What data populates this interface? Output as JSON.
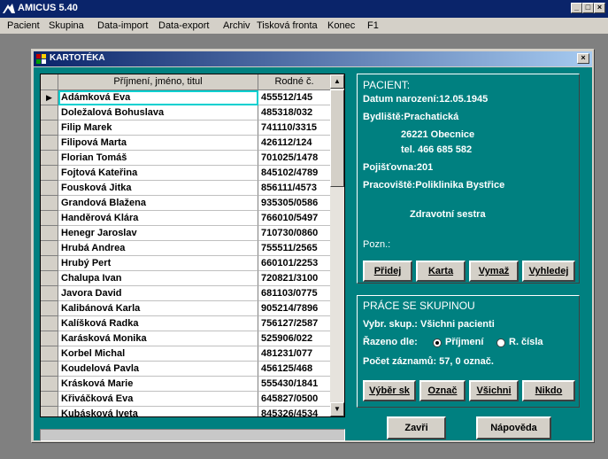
{
  "app": {
    "title": "AMICUS 5.40",
    "minimize": "_",
    "maximize": "□",
    "close": "×"
  },
  "menu": [
    "Pacient",
    "Skupina",
    "Data-import",
    "Data-export",
    "Archiv",
    "Tisková fronta",
    "Konec",
    "F1"
  ],
  "window": {
    "title": "KARTOTÉKA",
    "close": "×"
  },
  "grid": {
    "headers": [
      "Příjmení, jméno, titul",
      "Rodné č."
    ],
    "rows": [
      [
        "Adámková Eva",
        "455512/145"
      ],
      [
        "Doležalová Bohuslava",
        "485318/032"
      ],
      [
        "Filip Marek",
        "741110/3315"
      ],
      [
        "Filipová Marta",
        "426112/124"
      ],
      [
        "Florian Tomáš",
        "701025/1478"
      ],
      [
        "Fojtová Kateřina",
        "845102/4789"
      ],
      [
        "Fousková Jitka",
        "856111/4573"
      ],
      [
        "Grandová Blažena",
        "935305/0586"
      ],
      [
        "Handěrová Klára",
        "766010/5497"
      ],
      [
        "Henegr Jaroslav",
        "710730/0860"
      ],
      [
        "Hrubá Andrea",
        "755511/2565"
      ],
      [
        "Hrubý Pert",
        "660101/2253"
      ],
      [
        "Chalupa Ivan",
        "720821/3100"
      ],
      [
        "Javora David",
        "681103/0775"
      ],
      [
        "Kalibánová Karla",
        "905214/7896"
      ],
      [
        "Kalíšková Radka",
        "756127/2587"
      ],
      [
        "Karásková Monika",
        "525906/022"
      ],
      [
        "Korbel Michal",
        "481231/077"
      ],
      [
        "Koudelová Pavla",
        "456125/468"
      ],
      [
        "Krásková Marie",
        "555430/1841"
      ],
      [
        "Křiváčková Eva",
        "645827/0500"
      ],
      [
        "Kubásková Iveta",
        "845326/4534"
      ]
    ],
    "selected_row_marker": "▶"
  },
  "patient": {
    "heading": "PACIENT:",
    "birth": "Datum narození:12.05.1945",
    "address_label": "Bydliště:Prachatická",
    "address_city": "26221 Obecnice",
    "phone": "tel. 466 685 582",
    "insurance": "Pojišťovna:201",
    "workplace": "Pracoviště:Poliklinika Bystřice",
    "occupation": "Zdravotní sestra",
    "note": "Pozn.:",
    "buttons": [
      "Přidej",
      "Karta",
      "Vymaž",
      "Vyhledej"
    ]
  },
  "group": {
    "heading": "PRÁCE SE SKUPINOU",
    "selected_group": "Vybr. skup.: Všichni pacienti",
    "sort_label": "Řazeno dle:",
    "sort_options": [
      "Příjmení",
      "R. čísla"
    ],
    "sort_selected": "Příjmení",
    "count": "Počet záznamů: 57, 0 označ.",
    "buttons": [
      "Výběr sk",
      "Označ",
      "Všichni",
      "Nikdo"
    ]
  },
  "footer": {
    "close": "Zavři",
    "help": "Nápověda"
  },
  "colors": {
    "panel": "#008080",
    "titlebar": "#0a246a",
    "face": "#d4d0c8"
  }
}
